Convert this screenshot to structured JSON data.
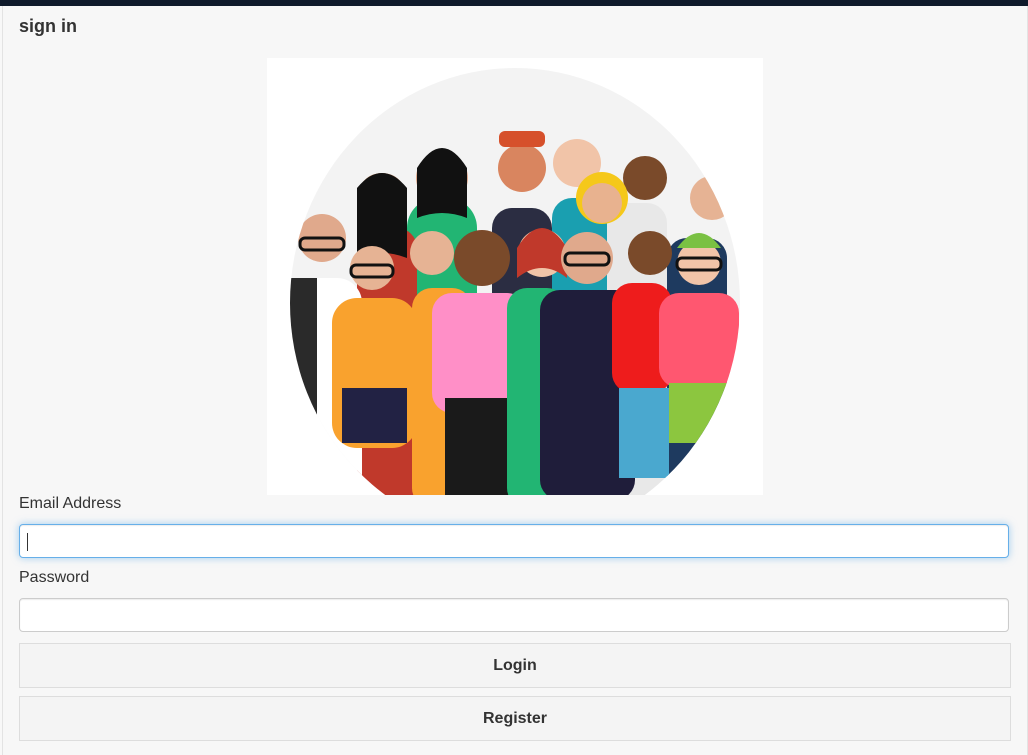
{
  "header": {
    "title": "sign in"
  },
  "hero": {
    "image": "people-crowd-illustration"
  },
  "form": {
    "email_label": "Email Address",
    "email_value": "",
    "password_label": "Password",
    "password_value": "",
    "login_label": "Login",
    "register_label": "Register"
  },
  "colors": {
    "focus": "#66afe9",
    "topbar": "#0f1a2b"
  }
}
